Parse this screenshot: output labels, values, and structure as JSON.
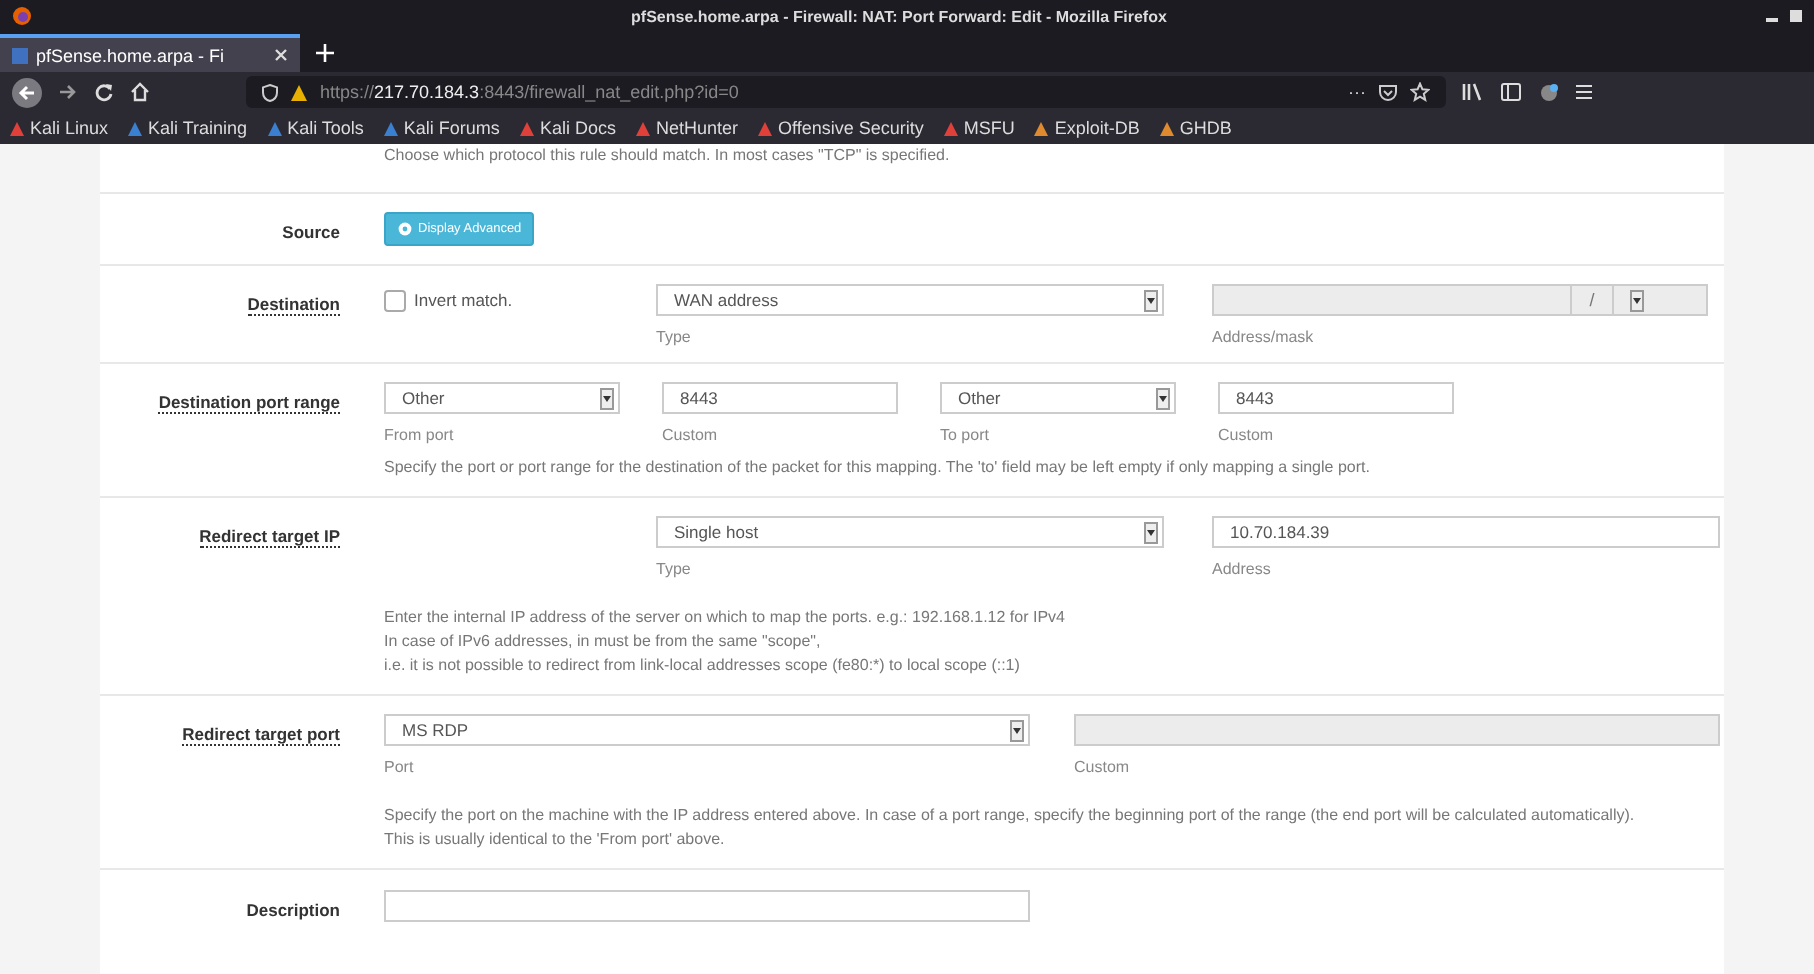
{
  "window": {
    "title": "pfSense.home.arpa - Firewall: NAT: Port Forward: Edit - Mozilla Firefox"
  },
  "tabs": [
    {
      "label": "pfSense.home.arpa - Fi",
      "selected": true
    }
  ],
  "url": {
    "secure_prefix": "https://",
    "host": "217.70.184.3",
    "rest": ":8443/firewall_nat_edit.php?id=0",
    "menu": "···"
  },
  "bookmarks": [
    {
      "label": "Kali Linux",
      "color": "#e0403a"
    },
    {
      "label": "Kali Training",
      "color": "#3a7fd0"
    },
    {
      "label": "Kali Tools",
      "color": "#3a7fd0"
    },
    {
      "label": "Kali Forums",
      "color": "#3a7fd0"
    },
    {
      "label": "Kali Docs",
      "color": "#e0403a"
    },
    {
      "label": "NetHunter",
      "color": "#e0403a"
    },
    {
      "label": "Offensive Security",
      "color": "#e0403a"
    },
    {
      "label": "MSFU",
      "color": "#e0403a"
    },
    {
      "label": "Exploit-DB",
      "color": "#e08a30"
    },
    {
      "label": "GHDB",
      "color": "#e08a30"
    }
  ],
  "protocol_hint": "Choose which protocol this rule should match. In most cases \"TCP\" is specified.",
  "source": {
    "label": "Source",
    "button": "Display Advanced"
  },
  "destination": {
    "label": "Destination",
    "invert_label": "Invert match.",
    "checked": false,
    "type_value": "WAN address",
    "type_caption": "Type",
    "address_caption": "Address/mask",
    "mask_separator": "/"
  },
  "destination_port_range": {
    "label": "Destination port range",
    "from_value": "Other",
    "from_caption": "From port",
    "from_custom": "8443",
    "from_custom_caption": "Custom",
    "to_value": "Other",
    "to_caption": "To port",
    "to_custom": "8443",
    "to_custom_caption": "Custom",
    "help": "Specify the port or port range for the destination of the packet for this mapping. The 'to' field may be left empty if only mapping a single port."
  },
  "redirect_target_ip": {
    "label": "Redirect target IP",
    "type_value": "Single host",
    "type_caption": "Type",
    "address": "10.70.184.39",
    "address_caption": "Address",
    "help": [
      "Enter the internal IP address of the server on which to map the ports. e.g.: 192.168.1.12 for IPv4",
      "In case of IPv6 addresses, in must be from the same \"scope\",",
      "i.e. it is not possible to redirect from link-local addresses scope (fe80:*) to local scope (::1)"
    ]
  },
  "redirect_target_port": {
    "label": "Redirect target port",
    "port_value": "MS RDP",
    "port_caption": "Port",
    "custom_caption": "Custom",
    "help": [
      "Specify the port on the machine with the IP address entered above. In case of a port range, specify the beginning port of the range (the end port will be calculated automatically).",
      "This is usually identical to the 'From port' above."
    ]
  },
  "description": {
    "label": "Description"
  }
}
